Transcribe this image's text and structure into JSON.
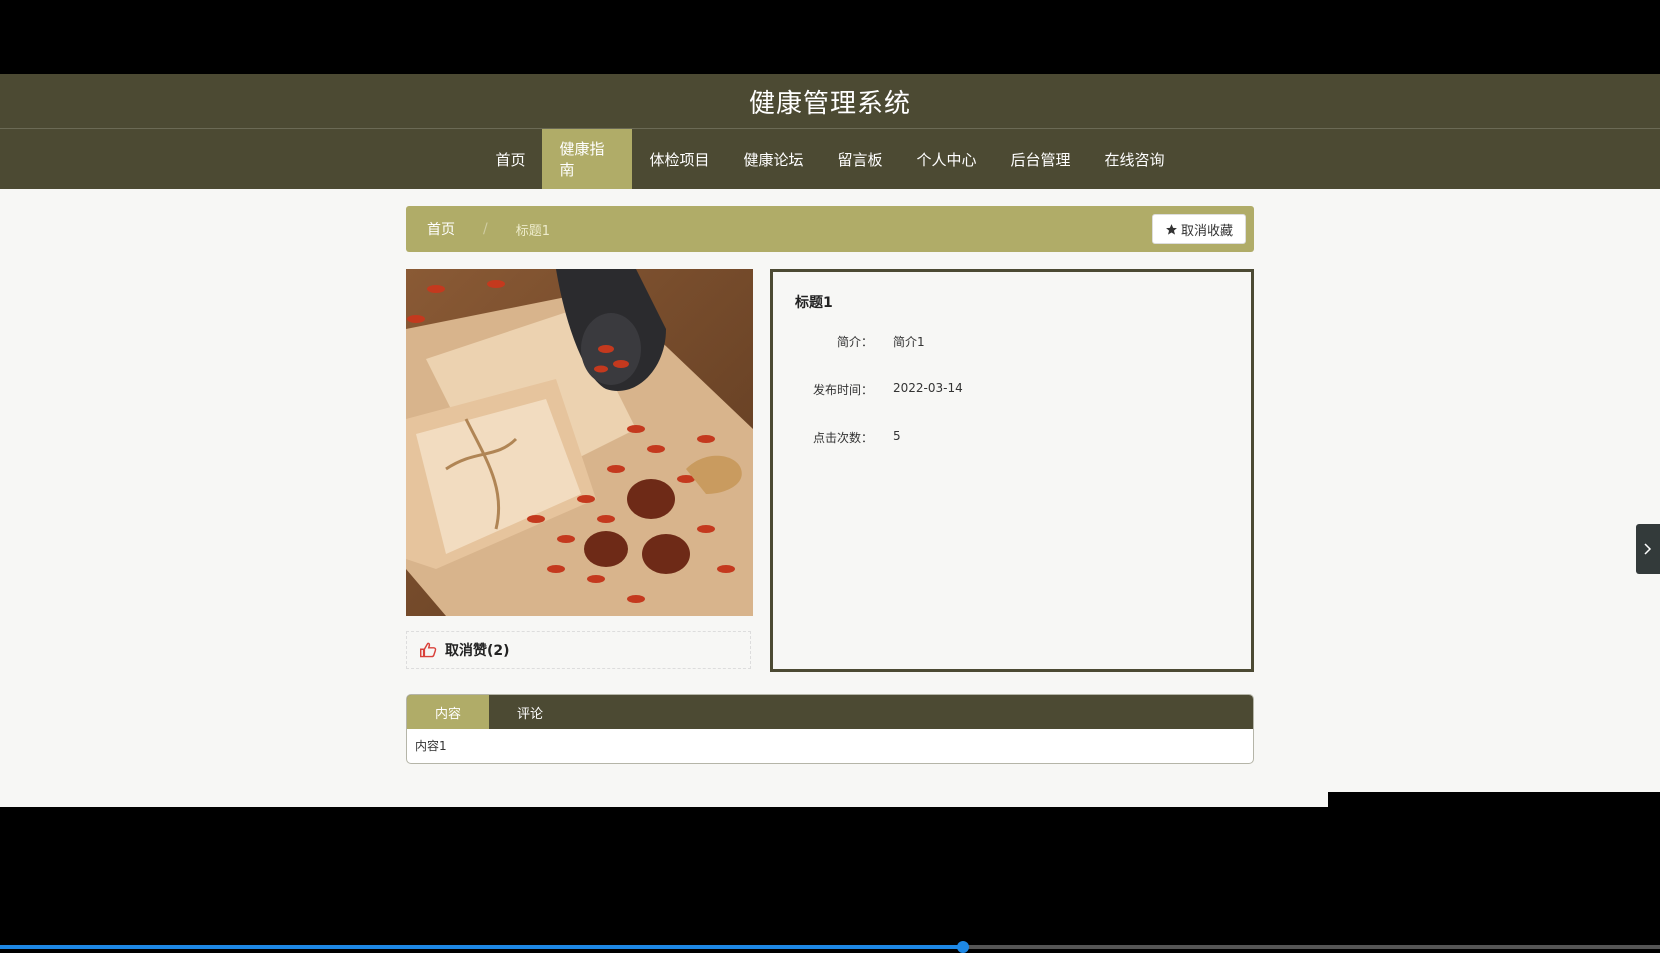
{
  "header": {
    "title": "健康管理系统"
  },
  "nav": {
    "items": [
      {
        "label": "首页"
      },
      {
        "label": "健康指南",
        "active": true
      },
      {
        "label": "体检项目"
      },
      {
        "label": "健康论坛"
      },
      {
        "label": "留言板"
      },
      {
        "label": "个人中心"
      },
      {
        "label": "后台管理"
      },
      {
        "label": "在线咨询"
      }
    ]
  },
  "breadcrumb": {
    "home": "首页",
    "separator": "/",
    "current": "标题1"
  },
  "favorite_button": {
    "label": "取消收藏",
    "icon": "star-icon"
  },
  "like": {
    "label": "取消赞(2)",
    "icon": "thumbs-up-icon"
  },
  "detail": {
    "title": "标题1",
    "fields": [
      {
        "label": "简介：",
        "value": "简介1"
      },
      {
        "label": "发布时间：",
        "value": "2022-03-14"
      },
      {
        "label": "点击次数：",
        "value": "5"
      }
    ]
  },
  "tabs": {
    "items": [
      {
        "label": "内容",
        "active": true
      },
      {
        "label": "评论"
      }
    ],
    "content": "内容1"
  },
  "video_progress": {
    "fraction": 0.58
  },
  "colors": {
    "header_bg": "#4c4a33",
    "accent": "#b0ac68",
    "like_icon": "#d9413a"
  }
}
